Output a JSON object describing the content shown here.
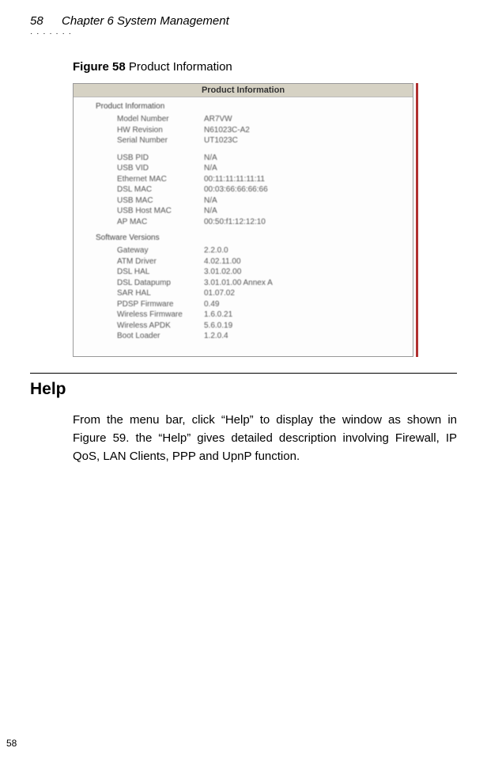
{
  "header": {
    "page_number_top": "58",
    "chapter_title": "Chapter 6 System Management"
  },
  "figure": {
    "label": "Figure 58",
    "caption": "Product Information",
    "panel_title": "Product Information",
    "sections": [
      {
        "title": "Product Information",
        "rows": [
          {
            "k": "Model Number",
            "v": "AR7VW"
          },
          {
            "k": "HW Revision",
            "v": "N61023C-A2"
          },
          {
            "k": "Serial Number",
            "v": "UT1023C"
          }
        ]
      },
      {
        "title": "",
        "rows": [
          {
            "k": "USB PID",
            "v": "N/A"
          },
          {
            "k": "USB VID",
            "v": "N/A"
          },
          {
            "k": "Ethernet MAC",
            "v": "00:11:11:11:11:11"
          },
          {
            "k": "DSL MAC",
            "v": "00:03:66:66:66:66"
          },
          {
            "k": "USB MAC",
            "v": "N/A"
          },
          {
            "k": "USB Host MAC",
            "v": "N/A"
          },
          {
            "k": "AP MAC",
            "v": "00:50:f1:12:12:10"
          }
        ]
      },
      {
        "title": "Software Versions",
        "rows": [
          {
            "k": "Gateway",
            "v": "2.2.0.0"
          },
          {
            "k": "ATM Driver",
            "v": "4.02.11.00"
          },
          {
            "k": "DSL HAL",
            "v": "3.01.02.00"
          },
          {
            "k": "DSL Datapump",
            "v": "3.01.01.00 Annex A"
          },
          {
            "k": "SAR HAL",
            "v": "01.07.02"
          },
          {
            "k": "PDSP Firmware",
            "v": "0.49"
          },
          {
            "k": "Wireless Firmware",
            "v": "1.6.0.21"
          },
          {
            "k": "Wireless APDK",
            "v": "5.6.0.19"
          },
          {
            "k": "Boot Loader",
            "v": "1.2.0.4"
          }
        ]
      }
    ]
  },
  "section_heading": "Help",
  "body_paragraph": "From the menu bar, click “Help” to display the window as shown in Figure 59. the “Help” gives detailed description involving Firewall, IP QoS, LAN Clients, PPP and UpnP function.",
  "footer_page_number": "58"
}
